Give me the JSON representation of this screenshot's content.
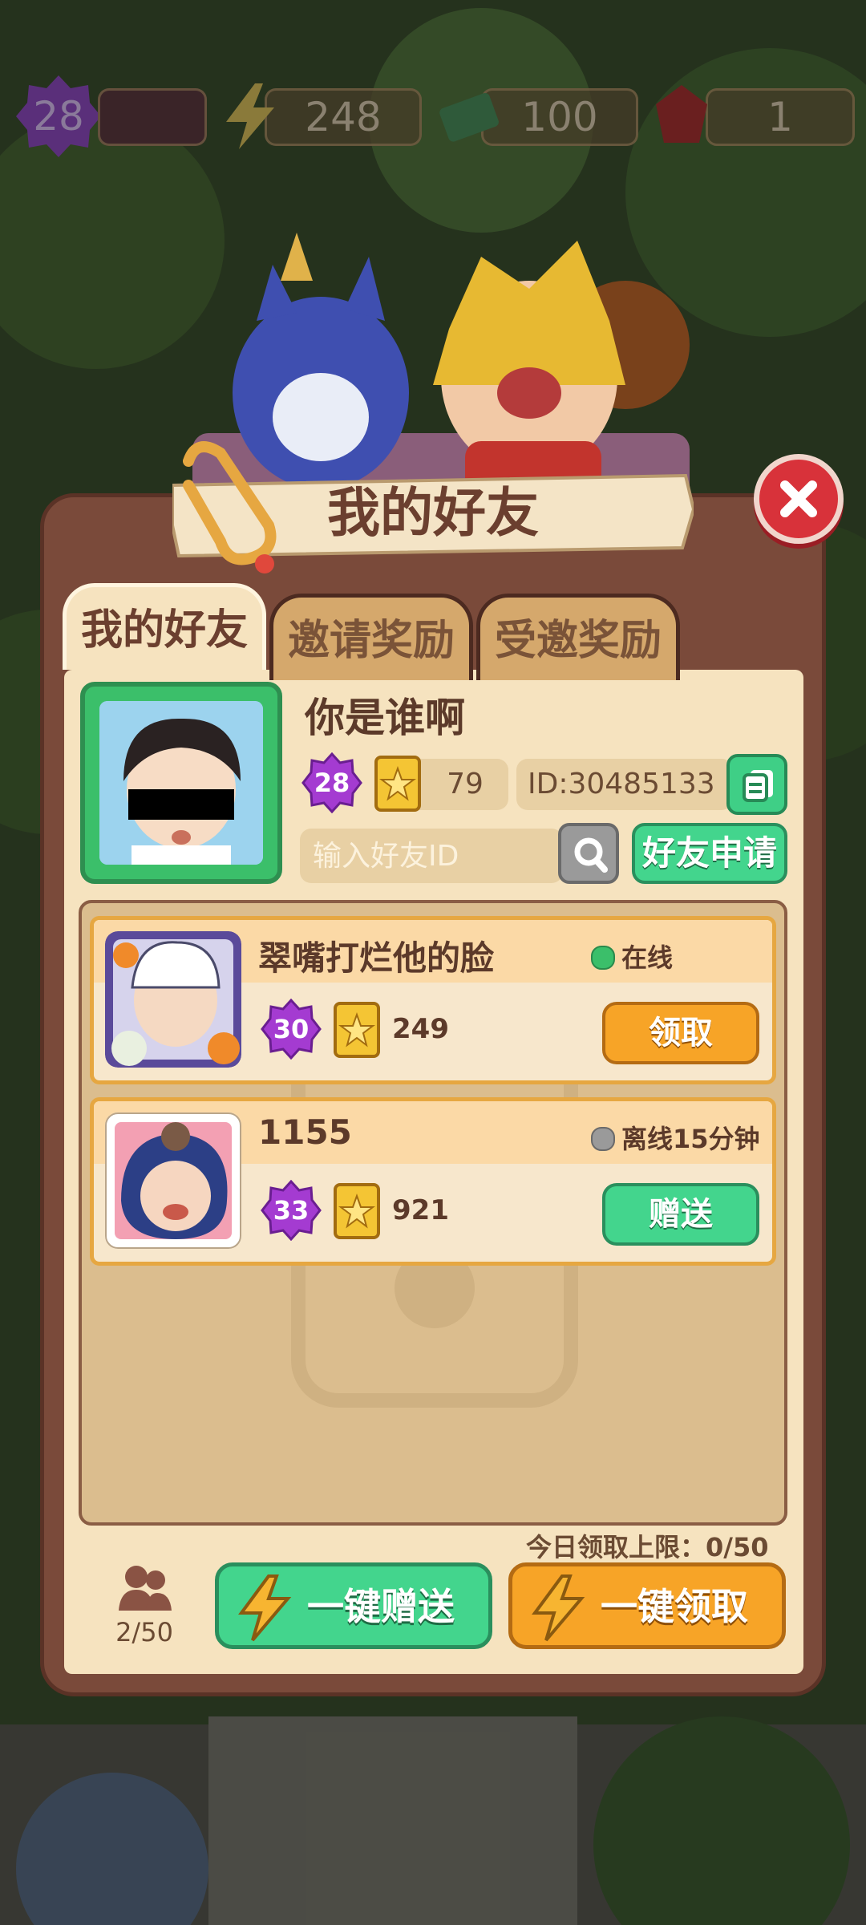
{
  "resources": {
    "level": "28",
    "energy": "248",
    "cash": "100",
    "gems": "1"
  },
  "dialog": {
    "title": "我的好友"
  },
  "tabs": [
    {
      "label": "我的好友",
      "active": true
    },
    {
      "label": "邀请奖励",
      "active": false
    },
    {
      "label": "受邀奖励",
      "active": false
    }
  ],
  "profile": {
    "name": "你是谁啊",
    "level": "28",
    "stars": "79",
    "id_text": "ID:30485133"
  },
  "search": {
    "placeholder": "输入好友ID",
    "apply_label": "好友申请"
  },
  "friends": [
    {
      "name": "翠嘴打烂他的脸",
      "status": "在线",
      "status_color": "#3bbf6a",
      "level": "30",
      "stars": "249",
      "action": "领取"
    },
    {
      "name": "1155",
      "status": "离线15分钟",
      "status_color": "#9a9a9a",
      "level": "33",
      "stars": "921",
      "action": "赠送"
    }
  ],
  "footer": {
    "daily_limit": "今日领取上限：0/50",
    "friend_count": "2/50",
    "send_all": "一键赠送",
    "claim_all": "一键领取"
  },
  "colors": {
    "panel": "#7a4a3a",
    "panel_inner": "#f6e3bf",
    "green_button": "#43d58d",
    "orange_button": "#f7a427",
    "close_red": "#d8323a"
  }
}
